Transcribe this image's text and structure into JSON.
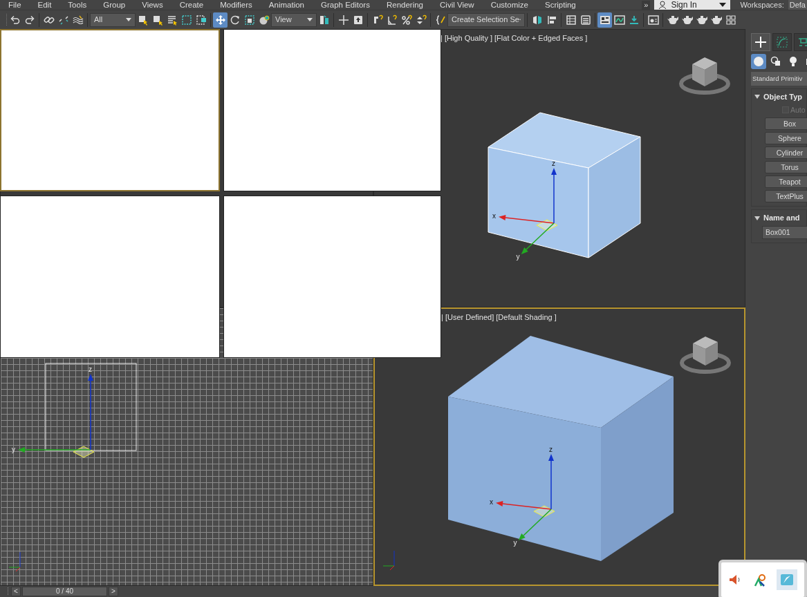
{
  "menu": [
    "File",
    "Edit",
    "Tools",
    "Group",
    "Views",
    "Create",
    "Modifiers",
    "Animation",
    "Graph Editors",
    "Rendering",
    "Civil View",
    "Customize",
    "Scripting"
  ],
  "menu_overflow": "»",
  "sign_in": {
    "label": "Sign In"
  },
  "workspaces": {
    "label": "Workspaces:",
    "value": "Defa"
  },
  "toolbar": [
    {
      "kind": "undo",
      "selected": false
    },
    {
      "kind": "redo",
      "selected": false
    },
    {
      "kind": "separator"
    },
    {
      "kind": "link",
      "selected": false
    },
    {
      "kind": "unlink",
      "selected": false
    },
    {
      "kind": "bind",
      "selected": false
    },
    {
      "kind": "separator"
    },
    {
      "kind": "dropdown",
      "value": "All"
    },
    {
      "kind": "select",
      "selected": false
    },
    {
      "kind": "select-region",
      "selected": false
    },
    {
      "kind": "select-name",
      "selected": false
    },
    {
      "kind": "rect-region",
      "selected": false
    },
    {
      "kind": "crossing",
      "selected": false
    },
    {
      "kind": "separator"
    },
    {
      "kind": "move",
      "selected": true
    },
    {
      "kind": "rotate",
      "selected": false
    },
    {
      "kind": "scale",
      "selected": false
    },
    {
      "kind": "pivot",
      "selected": false
    },
    {
      "kind": "dropdown",
      "value": "View"
    },
    {
      "kind": "pick",
      "selected": false
    },
    {
      "kind": "separator"
    },
    {
      "kind": "place",
      "selected": false
    },
    {
      "kind": "upload",
      "selected": false
    },
    {
      "kind": "separator"
    },
    {
      "kind": "snap",
      "selected": false
    },
    {
      "kind": "angle",
      "selected": false
    },
    {
      "kind": "percent",
      "selected": false
    },
    {
      "kind": "spinner",
      "selected": false
    },
    {
      "kind": "separator"
    },
    {
      "kind": "braces",
      "selected": false
    },
    {
      "kind": "dropdown",
      "value": "Create Selection Se"
    },
    {
      "kind": "separator"
    },
    {
      "kind": "mirror",
      "selected": false
    },
    {
      "kind": "align",
      "selected": false
    },
    {
      "kind": "separator"
    },
    {
      "kind": "table",
      "selected": false
    },
    {
      "kind": "layers",
      "selected": false
    },
    {
      "kind": "separator"
    },
    {
      "kind": "layout",
      "selected": true
    },
    {
      "kind": "curve",
      "selected": false
    },
    {
      "kind": "download",
      "selected": false
    },
    {
      "kind": "separator"
    },
    {
      "kind": "render-setup",
      "selected": false
    },
    {
      "kind": "separator"
    },
    {
      "kind": "teapot",
      "selected": false
    },
    {
      "kind": "teapot",
      "selected": false
    },
    {
      "kind": "teapot",
      "selected": false
    },
    {
      "kind": "teapot",
      "selected": false
    },
    {
      "kind": "grid",
      "selected": false
    }
  ],
  "viewports": [
    {
      "kind": "shaded",
      "selected": false,
      "label": "| [High Quality ] [Flat Color + Edged Faces ]",
      "edged_faces": true,
      "gizmo_axes": [
        "x",
        "y",
        "z"
      ]
    },
    {
      "kind": "grid",
      "selected": false,
      "gizmo_axes": [
        "y",
        "z"
      ]
    },
    {
      "kind": "shaded",
      "selected": true,
      "label": "| [User Defined] [Default Shading ]",
      "edged_faces": false,
      "gizmo_axes": [
        "x",
        "y",
        "z"
      ]
    }
  ],
  "preview_panels": [
    {
      "selected": true
    },
    {
      "selected": false
    },
    {
      "selected": false
    },
    {
      "selected": false
    }
  ],
  "command_panel": {
    "tabs": [
      {
        "kind": "create",
        "selected": true
      },
      {
        "kind": "modify",
        "selected": false
      },
      {
        "kind": "hierarchy",
        "selected": false
      }
    ],
    "categories": [
      {
        "kind": "geometry",
        "selected": true
      },
      {
        "kind": "shapes",
        "selected": false
      },
      {
        "kind": "lights",
        "selected": false
      },
      {
        "kind": "cameras",
        "selected": false
      }
    ],
    "dropdown": "Standard Primitiv",
    "rollouts": [
      {
        "title": "Object Typ",
        "expanded": true,
        "checkbox": {
          "label": "Auto",
          "checked": false,
          "disabled": true
        },
        "buttons": [
          "Box",
          "Sphere",
          "Cylinder",
          "Torus",
          "Teapot",
          "TextPlus"
        ]
      },
      {
        "title": "Name and",
        "expanded": true,
        "field": "Box001"
      }
    ]
  },
  "timeline": {
    "prev": "<",
    "frame": "0 / 40",
    "next": ">",
    "level": 0
  },
  "tray": [
    {
      "kind": "speaker",
      "selected": false
    },
    {
      "kind": "network",
      "selected": false
    },
    {
      "kind": "app",
      "selected": true
    }
  ]
}
